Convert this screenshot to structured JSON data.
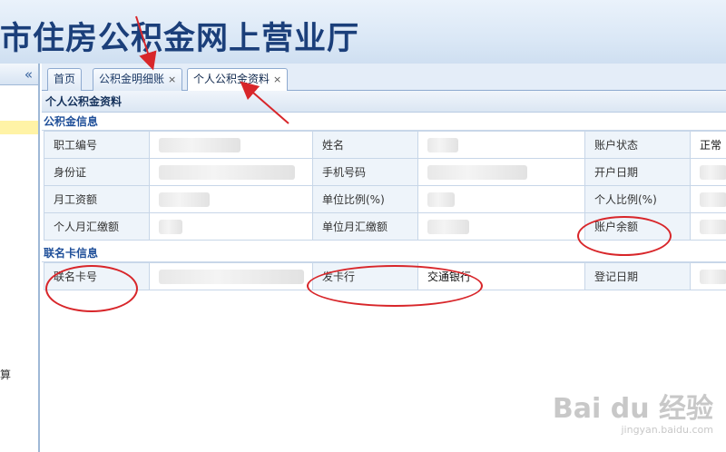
{
  "header": {
    "title": "市住房公积金网上营业厅"
  },
  "sidebar": {
    "collapse_icon": "«",
    "partial_glyph": "算"
  },
  "tabs": [
    {
      "label": "首页",
      "closable": false,
      "active": false
    },
    {
      "label": "公积金明细账",
      "closable": true,
      "active": false
    },
    {
      "label": "个人公积金资料",
      "closable": true,
      "active": true
    }
  ],
  "tab_close_glyph": "×",
  "panel": {
    "title": "个人公积金资料",
    "section_fund": "公积金信息",
    "section_card": "联名卡信息",
    "fund_rows": [
      [
        {
          "label": "职工编号",
          "value": ""
        },
        {
          "label": "姓名",
          "value": ""
        },
        {
          "label": "账户状态",
          "value": "正常"
        }
      ],
      [
        {
          "label": "身份证",
          "value": ""
        },
        {
          "label": "手机号码",
          "value": ""
        },
        {
          "label": "开户日期",
          "value": ""
        }
      ],
      [
        {
          "label": "月工资额",
          "value": ""
        },
        {
          "label": "单位比例(%)",
          "value": ""
        },
        {
          "label": "个人比例(%)",
          "value": ""
        }
      ],
      [
        {
          "label": "个人月汇缴额",
          "value": ""
        },
        {
          "label": "单位月汇缴额",
          "value": ""
        },
        {
          "label": "账户余额",
          "value": ""
        }
      ]
    ],
    "card_row": [
      {
        "label": "联名卡号",
        "value": ""
      },
      {
        "label": "发卡行",
        "value": "交通银行"
      },
      {
        "label": "登记日期",
        "value": ""
      }
    ]
  },
  "watermark": {
    "main": "Bai du 经验",
    "sub": "jingyan.baidu.com"
  },
  "colors": {
    "banner_title": "#1b3f7a",
    "section_title": "#1f4f99",
    "annotation_red": "#d8262a"
  }
}
